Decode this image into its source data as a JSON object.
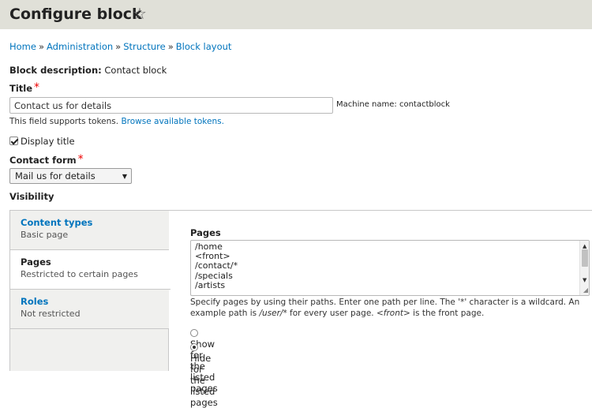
{
  "header": {
    "title": "Configure block",
    "star_glyph": "☆"
  },
  "breadcrumb": {
    "items": [
      "Home",
      "Administration",
      "Structure",
      "Block layout"
    ],
    "separator": "»"
  },
  "block_description": {
    "label": "Block description:",
    "value": "Contact block"
  },
  "title_field": {
    "label": "Title",
    "required_mark": "*",
    "value": "Contact us for details",
    "machine_name": "Machine name: contactblock",
    "tokens_prefix": "This field supports tokens.",
    "tokens_link": "Browse available tokens."
  },
  "display_title": {
    "label": "Display title",
    "checked": true
  },
  "contact_form": {
    "label": "Contact form",
    "required_mark": "*",
    "selected": "Mail us for details",
    "arrow_glyph": "▼"
  },
  "visibility": {
    "label": "Visibility",
    "tabs": [
      {
        "title": "Content types",
        "summary": "Basic page"
      },
      {
        "title": "Pages",
        "summary": "Restricted to certain pages"
      },
      {
        "title": "Roles",
        "summary": "Not restricted"
      }
    ],
    "selected_tab": "Pages"
  },
  "pages_pane": {
    "label": "Pages",
    "lines": [
      "/home",
      "<front>",
      "/contact/*",
      "/specials",
      "/artists"
    ],
    "description_1": "Specify pages by using their paths. Enter one path per line. The '*' character is a wildcard. An",
    "description_2a": "example path is ",
    "description_2b": "/user/*",
    "description_2c": " for every user page. ",
    "description_2d": "<front>",
    "description_2e": " is the front page.",
    "options": [
      {
        "label": "Show for the listed pages",
        "checked": false
      },
      {
        "label": "Hide for the listed pages",
        "checked": true
      }
    ]
  },
  "colors": {
    "header_bg": "#e0e0d8",
    "link": "#0074bd",
    "required": "#e00000",
    "tab_bg": "#f0f0ee"
  }
}
